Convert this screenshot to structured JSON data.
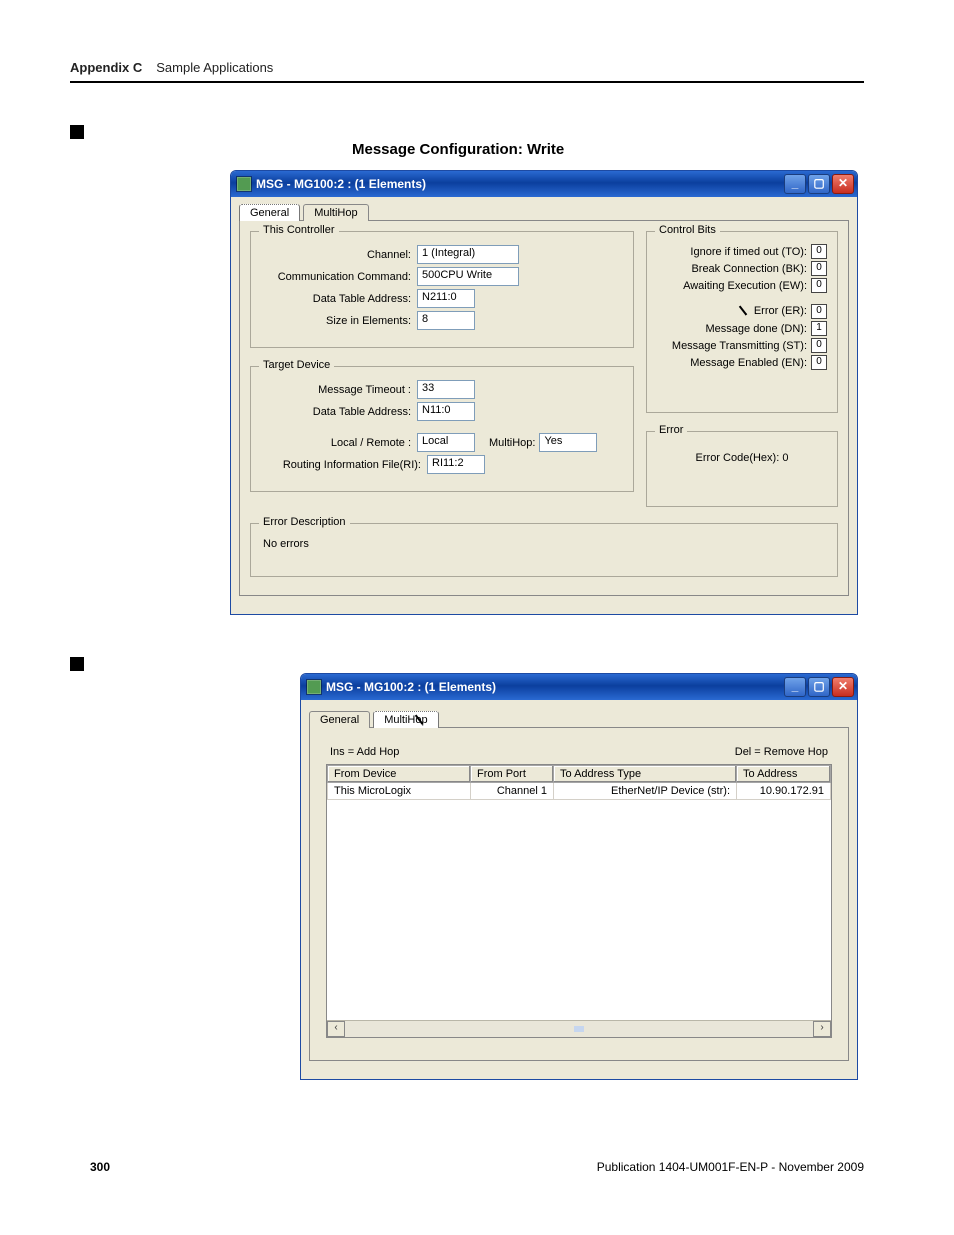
{
  "header": {
    "appendix": "Appendix C",
    "chapter": "Sample Applications"
  },
  "section_title": "Message Configuration: Write",
  "dialog1": {
    "title": "MSG - MG100:2 : (1 Elements)",
    "tabs": {
      "general": "General",
      "multihop": "MultiHop"
    },
    "this_controller": {
      "legend": "This Controller",
      "channel_label": "Channel:",
      "channel_value": "1 (Integral)",
      "comm_cmd_label": "Communication Command:",
      "comm_cmd_value": "500CPU Write",
      "dta_label": "Data Table Address:",
      "dta_value": "N211:0",
      "size_label": "Size in Elements:",
      "size_value": "8"
    },
    "target_device": {
      "legend": "Target Device",
      "msg_to_label": "Message Timeout :",
      "msg_to_value": "33",
      "dta_label": "Data Table Address:",
      "dta_value": "N11:0",
      "lr_label": "Local / Remote :",
      "lr_value": "Local",
      "mh_label": "MultiHop:",
      "mh_value": "Yes",
      "rif_label": "Routing Information File(RI):",
      "rif_value": "RI11:2"
    },
    "control_bits": {
      "legend": "Control Bits",
      "to": {
        "label": "Ignore if timed out (TO):",
        "val": "0"
      },
      "bk": {
        "label": "Break Connection (BK):",
        "val": "0"
      },
      "ew": {
        "label": "Awaiting Execution (EW):",
        "val": "0"
      },
      "er": {
        "label": "Error (ER):",
        "val": "0"
      },
      "dn": {
        "label": "Message done (DN):",
        "val": "1"
      },
      "st": {
        "label": "Message Transmitting (ST):",
        "val": "0"
      },
      "en": {
        "label": "Message Enabled (EN):",
        "val": "0"
      }
    },
    "error_box": {
      "legend": "Error",
      "line": "Error Code(Hex): 0"
    },
    "error_desc": {
      "legend": "Error Description",
      "text": "No errors"
    }
  },
  "dialog2": {
    "title": "MSG - MG100:2 : (1 Elements)",
    "tabs": {
      "general": "General",
      "multihop": "MultiHop"
    },
    "hint_ins": "Ins = Add Hop",
    "hint_del": "Del = Remove Hop",
    "headers": {
      "from_device": "From Device",
      "from_port": "From Port",
      "to_addr_type": "To Address Type",
      "to_addr": "To Address"
    },
    "row": {
      "from_device": "This MicroLogix",
      "from_port": "Channel 1",
      "to_addr_type": "EtherNet/IP Device (str):",
      "to_addr": "10.90.172.91"
    }
  },
  "footer": {
    "page": "300",
    "pub": "Publication 1404-UM001F-EN-P - November 2009"
  }
}
